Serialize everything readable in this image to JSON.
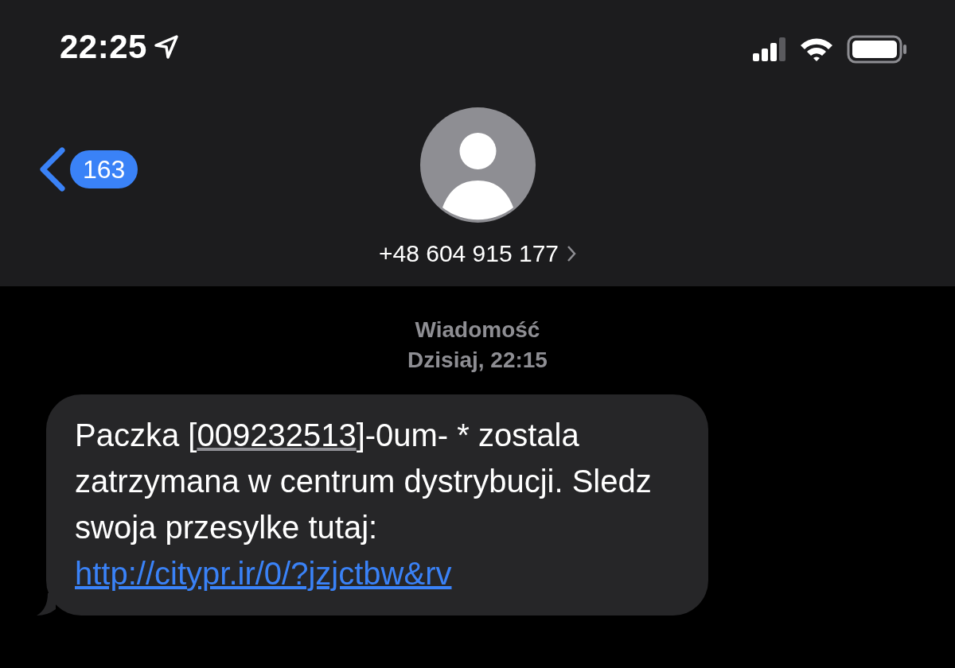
{
  "status_bar": {
    "time": "22:25"
  },
  "header": {
    "unread_count": "163",
    "contact": "+48 604 915 177"
  },
  "thread": {
    "label": "Wiadomość",
    "timestamp": "Dzisiaj, 22:15",
    "messages": [
      {
        "segments": [
          {
            "kind": "plain",
            "text": "Paczka ["
          },
          {
            "kind": "data-link",
            "text": "009232513"
          },
          {
            "kind": "plain",
            "text": "]-0um- * zostala zatrzymana w centrum dystrybucji. Sledz swoja przesylke tutaj: "
          },
          {
            "kind": "link",
            "text": "http://citypr.ir/0/?jzjctbw&rv"
          }
        ]
      }
    ]
  }
}
